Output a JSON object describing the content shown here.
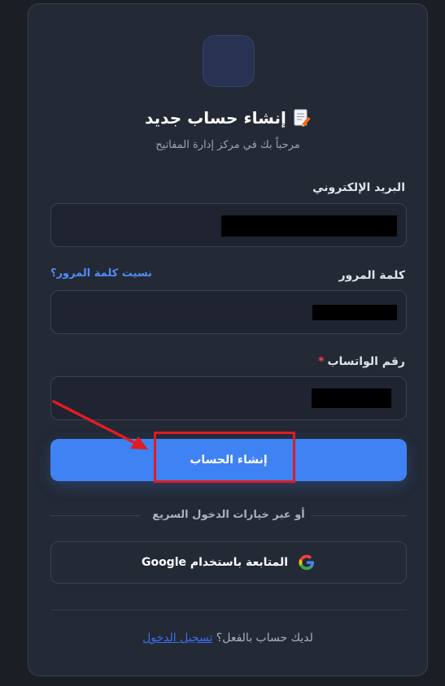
{
  "header": {
    "title": "إنشاء حساب جديد",
    "subtitle": "مرحباً بك في مركز إدارة المفاتيح"
  },
  "form": {
    "email_label": "البريد الإلكتروني",
    "email_value": "[redacted]",
    "password_label": "كلمة المرور",
    "forgot_password": "نسيت كلمة المرور؟",
    "password_value": "[redacted]",
    "whatsapp_label": "رقم الواتساب",
    "whatsapp_required": "*",
    "whatsapp_value": "[redacted]",
    "submit_label": "إنشاء الحساب"
  },
  "alt_login": {
    "divider_text": "أو عبر خيارات الدخول السريع",
    "google_label": "المتابعة باستخدام Google"
  },
  "footer": {
    "prompt": "لديك حساب بالفعل؟",
    "login_link": "تسجيل الدخول"
  },
  "icons": {
    "title_icon": "memo-pencil-icon",
    "google_icon": "google-logo-icon"
  },
  "colors": {
    "background": "#1b1e24",
    "card": "#232935",
    "primary_button": "#3f82f3",
    "link": "#4f8df5",
    "required": "#ef4444",
    "annotation": "#e21b22"
  }
}
